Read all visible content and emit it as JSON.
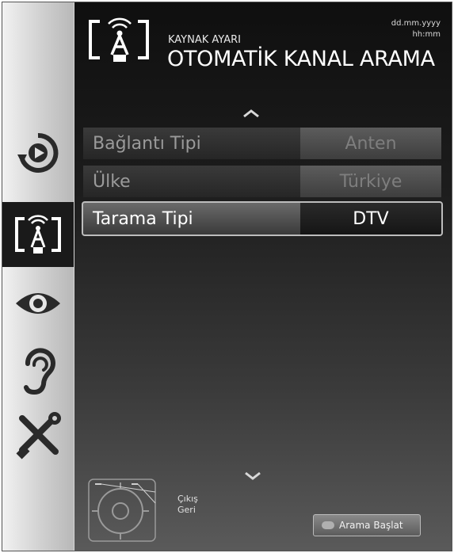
{
  "header": {
    "subtitle": "KAYNAK AYARI",
    "title": "OTOMATİK KANAL ARAMA",
    "date": "dd.mm.yyyy",
    "time": "hh:mm"
  },
  "rows": [
    {
      "label": "Bağlantı Tipi",
      "value": "Anten"
    },
    {
      "label": "Ülke",
      "value": "Türkiye"
    },
    {
      "label": "Tarama Tipi",
      "value": "DTV"
    }
  ],
  "footer": {
    "hint_exit": "Çıkış",
    "hint_back": "Geri",
    "start_label": "Arama Başlat"
  },
  "sidebar": {
    "items": [
      {
        "icon": "source-icon"
      },
      {
        "icon": "antenna-source-icon"
      },
      {
        "icon": "eye-icon"
      },
      {
        "icon": "ear-icon"
      },
      {
        "icon": "tools-icon"
      }
    ]
  },
  "colors": {
    "panel_background": "#1d1d1d",
    "selected_outline": "#bdbdbd",
    "active_sidebar": "#1a1a1a"
  }
}
